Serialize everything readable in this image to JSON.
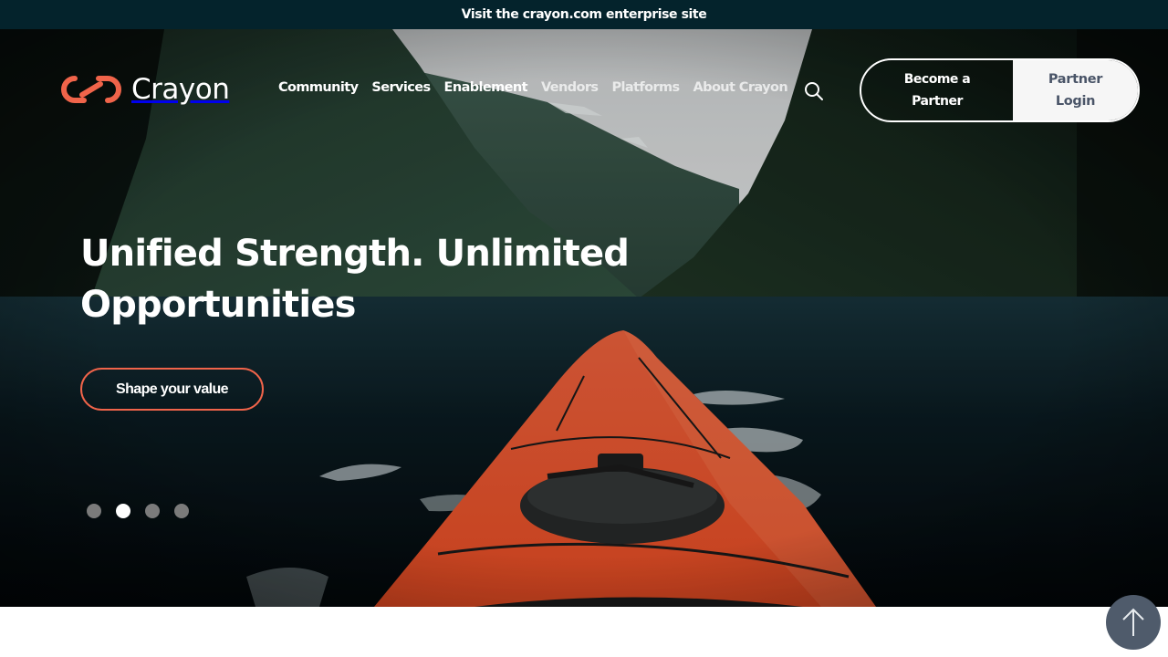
{
  "topbar": {
    "link_text": "Visit the crayon.com enterprise site"
  },
  "header": {
    "logo_text": "Crayon",
    "logo_icon": "infinity-link-icon",
    "nav": [
      {
        "label": "Community"
      },
      {
        "label": "Services"
      },
      {
        "label": "Enablement"
      },
      {
        "label": "Vendors"
      },
      {
        "label": "Platforms"
      },
      {
        "label": "About Crayon"
      }
    ],
    "search_icon": "search-icon",
    "become_partner_label": "Become a Partner",
    "partner_login_label": "Partner Login"
  },
  "hero": {
    "headline": "Unified Strength. Unlimited Opportunities",
    "cta_label": "Shape your value",
    "slider": {
      "total_slides": 4,
      "active_slide": 2
    }
  },
  "scroll_top": {
    "icon": "arrow-up-icon"
  },
  "colors": {
    "brand_orange": "#f0644a",
    "topbar_bg": "#04232c",
    "login_text": "#4a5568",
    "scroll_top_bg": "#4f5b6b"
  }
}
